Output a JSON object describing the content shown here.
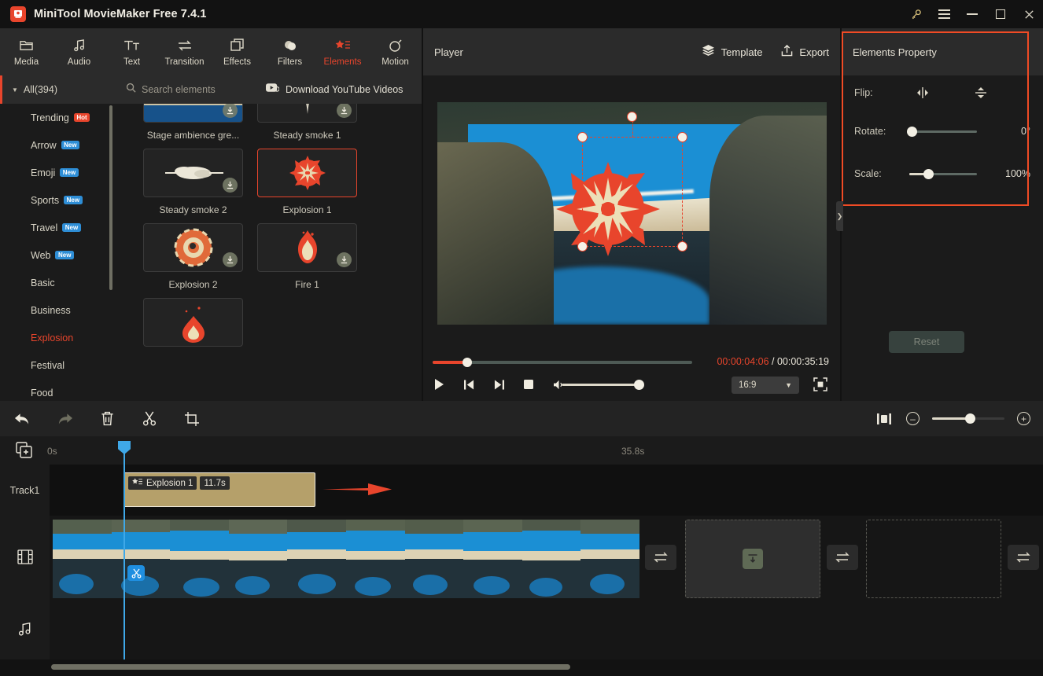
{
  "window": {
    "title": "MiniTool MovieMaker Free 7.4.1",
    "logo_glyph": "M",
    "controls": {
      "key": "key-icon",
      "menu": "menu-icon",
      "minimize": "—",
      "maximize": "□",
      "close": "✕"
    }
  },
  "toolbar": {
    "items": [
      {
        "label": "Media",
        "icon": "folder-icon",
        "active": false
      },
      {
        "label": "Audio",
        "icon": "music-note-icon",
        "active": false
      },
      {
        "label": "Text",
        "icon": "text-icon",
        "active": false
      },
      {
        "label": "Transition",
        "icon": "transition-icon",
        "active": false
      },
      {
        "label": "Effects",
        "icon": "effects-icon",
        "active": false
      },
      {
        "label": "Filters",
        "icon": "filters-icon",
        "active": false
      },
      {
        "label": "Elements",
        "icon": "elements-icon",
        "active": true
      },
      {
        "label": "Motion",
        "icon": "motion-icon",
        "active": false
      }
    ]
  },
  "sidebar": {
    "all_label": "All(394)",
    "items": [
      {
        "label": "Trending",
        "badge": "Hot",
        "badge_kind": "hot",
        "selected": false
      },
      {
        "label": "Arrow",
        "badge": "New",
        "badge_kind": "new",
        "selected": false
      },
      {
        "label": "Emoji",
        "badge": "New",
        "badge_kind": "new",
        "selected": false
      },
      {
        "label": "Sports",
        "badge": "New",
        "badge_kind": "new",
        "selected": false
      },
      {
        "label": "Travel",
        "badge": "New",
        "badge_kind": "new",
        "selected": false
      },
      {
        "label": "Web",
        "badge": "New",
        "badge_kind": "new",
        "selected": false
      },
      {
        "label": "Basic",
        "badge": "",
        "badge_kind": "",
        "selected": false
      },
      {
        "label": "Business",
        "badge": "",
        "badge_kind": "",
        "selected": false
      },
      {
        "label": "Explosion",
        "badge": "",
        "badge_kind": "",
        "selected": true
      },
      {
        "label": "Festival",
        "badge": "",
        "badge_kind": "",
        "selected": false
      },
      {
        "label": "Food",
        "badge": "",
        "badge_kind": "",
        "selected": false
      }
    ]
  },
  "search": {
    "placeholder": "Search elements",
    "icon": "search-icon",
    "download_label": "Download YouTube Videos",
    "download_icon": "youtube-icon"
  },
  "elements_grid": {
    "items": [
      {
        "name": "Stage ambience gre...",
        "selected": false,
        "downloadable": true,
        "kind": "stage"
      },
      {
        "name": "Steady smoke 1",
        "selected": false,
        "downloadable": true,
        "kind": "smoke1"
      },
      {
        "name": "Steady smoke 2",
        "selected": false,
        "downloadable": true,
        "kind": "smoke2"
      },
      {
        "name": "Explosion 1",
        "selected": true,
        "downloadable": false,
        "kind": "explosion1"
      },
      {
        "name": "Explosion 2",
        "selected": false,
        "downloadable": true,
        "kind": "explosion2"
      },
      {
        "name": "Fire 1",
        "selected": false,
        "downloadable": true,
        "kind": "fire1"
      }
    ]
  },
  "player": {
    "title": "Player",
    "template_label": "Template",
    "template_icon": "layers-icon",
    "export_label": "Export",
    "export_icon": "upload-icon",
    "current_time": "00:00:04:06",
    "separator": " / ",
    "total_time": "00:00:35:19",
    "aspect_ratio": "16:9",
    "controls": {
      "play": "play-icon",
      "prev": "previous-frame-icon",
      "next": "next-frame-icon",
      "stop": "stop-icon",
      "volume": "volume-icon",
      "fullscreen": "fullscreen-icon"
    }
  },
  "properties": {
    "title": "Elements Property",
    "flip_label": "Flip:",
    "flip_horizontal_icon": "flip-horizontal-icon",
    "flip_vertical_icon": "flip-vertical-icon",
    "rotate_label": "Rotate:",
    "rotate_value": "0°",
    "scale_label": "Scale:",
    "scale_value": "100%",
    "reset_label": "Reset",
    "highlight_color": "#f04b25"
  },
  "timeline_toolbar": {
    "undo_icon": "undo-icon",
    "redo_icon": "redo-icon",
    "delete_icon": "trash-icon",
    "split_icon": "scissors-icon",
    "crop_icon": "crop-icon",
    "fit_icon": "fit-timeline-icon",
    "zoom_out_icon": "zoom-out-icon",
    "zoom_in_icon": "zoom-in-icon"
  },
  "timeline": {
    "add_icon": "add-media-icon",
    "ruler_start": "0s",
    "ruler_end": "35.8s",
    "track1_label": "Track1",
    "video_track_icon": "film-icon",
    "audio_track_icon": "music-icon",
    "clip": {
      "name": "Explosion 1",
      "icon": "elements-clip-icon",
      "duration": "11.7s"
    },
    "annotation": {
      "kind": "red-arrow",
      "color": "#e8452c"
    },
    "transition_icon": "transition-slot-icon",
    "download_slot_icon": "download-icon"
  },
  "colors": {
    "accent": "#e8452c",
    "panel": "#1b1b1b",
    "header": "#2b2b2b",
    "text": "#e8e4d8",
    "clip": "#b5a06a",
    "playhead": "#3fa8e8"
  }
}
